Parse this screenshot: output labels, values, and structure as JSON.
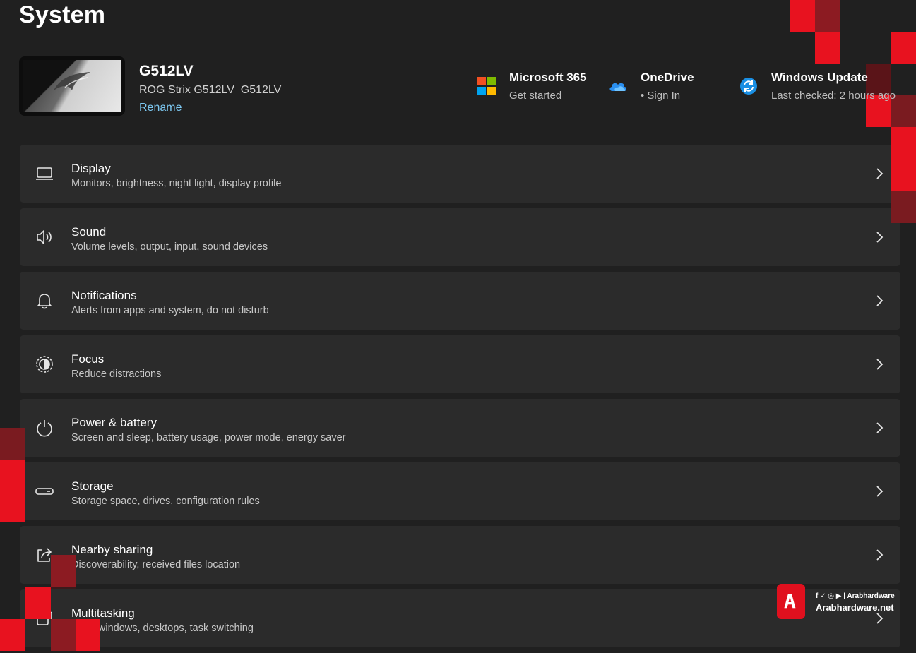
{
  "page": {
    "title": "System"
  },
  "device": {
    "name": "G512LV",
    "model": "ROG Strix G512LV_G512LV",
    "rename_label": "Rename"
  },
  "quick_links": [
    {
      "title": "Microsoft 365",
      "subtitle": "Get started",
      "icon": "microsoft-logo-icon"
    },
    {
      "title": "OneDrive",
      "subtitle": "• Sign In",
      "icon": "onedrive-cloud-icon"
    },
    {
      "title": "Windows Update",
      "subtitle": "Last checked: 2 hours ago",
      "icon": "windows-update-icon"
    }
  ],
  "settings": [
    {
      "title": "Display",
      "subtitle": "Monitors, brightness, night light, display profile",
      "icon": "display-icon"
    },
    {
      "title": "Sound",
      "subtitle": "Volume levels, output, input, sound devices",
      "icon": "speaker-icon"
    },
    {
      "title": "Notifications",
      "subtitle": "Alerts from apps and system, do not disturb",
      "icon": "bell-icon"
    },
    {
      "title": "Focus",
      "subtitle": "Reduce distractions",
      "icon": "focus-icon"
    },
    {
      "title": "Power & battery",
      "subtitle": "Screen and sleep, battery usage, power mode, energy saver",
      "icon": "power-icon"
    },
    {
      "title": "Storage",
      "subtitle": "Storage space, drives, configuration rules",
      "icon": "storage-drive-icon"
    },
    {
      "title": "Nearby sharing",
      "subtitle": "Discoverability, received files location",
      "icon": "share-icon"
    },
    {
      "title": "Multitasking",
      "subtitle": "Snap windows, desktops, task switching",
      "icon": "multitasking-icon"
    }
  ],
  "watermark": {
    "logo_letter": "A",
    "social": "f ✓ ◎ ▶ | Arabhardware",
    "site": "Arabhardware.net"
  },
  "colors": {
    "background": "#202020",
    "card": "#2b2b2b",
    "accent_link": "#7cc7f0",
    "deco_red": "#e8121f",
    "deco_dark_red": "#8c1b22"
  }
}
